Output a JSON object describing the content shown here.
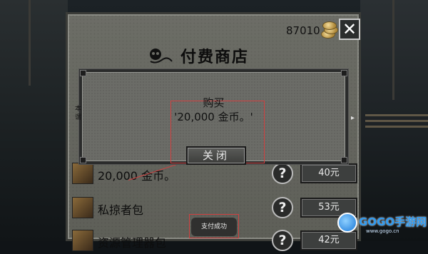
{
  "shop": {
    "title": "付费商店",
    "coins": "87010",
    "close_glyph": "✕"
  },
  "items": [
    {
      "label": "20,000 金币。",
      "price": "40元",
      "icon": "gold-coins-icon"
    },
    {
      "label": "私掠者包",
      "price": "53元",
      "icon": "privateer-pack-icon"
    },
    {
      "label": "资源管理器包",
      "price": "42元",
      "icon": "resource-pack-icon"
    }
  ],
  "dialog": {
    "title": "购买",
    "message": "'20,000 金币。'",
    "close_label": "关闭",
    "side_chars": [
      "本",
      "谓"
    ]
  },
  "toast": {
    "text": "支付成功"
  },
  "watermark": {
    "brand": "GOGO手游网",
    "url": "www.gogo.cn"
  },
  "colors": {
    "annotation_red": "#d04040",
    "watermark_blue": "#2f9af0"
  }
}
